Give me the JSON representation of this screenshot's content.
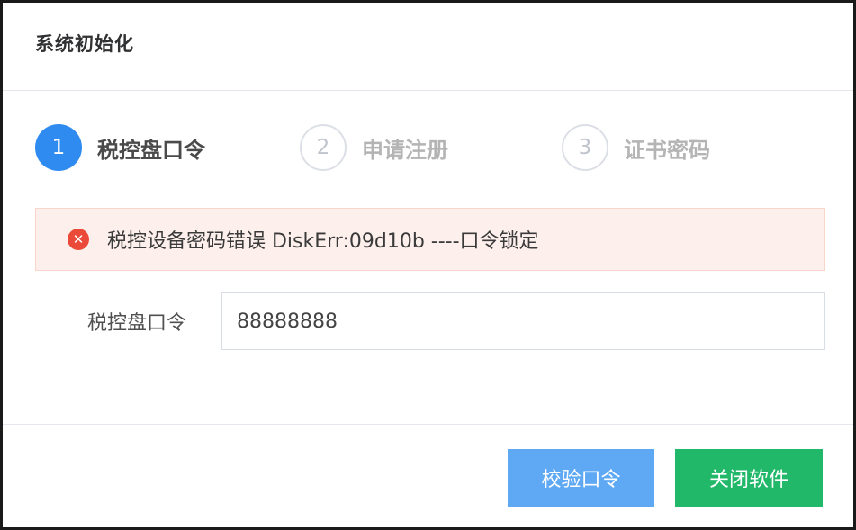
{
  "dialog": {
    "title": "系统初始化"
  },
  "steps": [
    {
      "number": "1",
      "label": "税控盘口令",
      "state": "active"
    },
    {
      "number": "2",
      "label": "申请注册",
      "state": "wait"
    },
    {
      "number": "3",
      "label": "证书密码",
      "state": "wait"
    }
  ],
  "alert": {
    "icon": "error-circle-icon",
    "message": "税控设备密码错误 DiskErr:09d10b ----口令锁定",
    "color": "#ea4a37"
  },
  "form": {
    "password_label": "税控盘口令",
    "password_value": "88888888"
  },
  "buttons": {
    "verify_label": "校验口令",
    "close_label": "关闭软件"
  },
  "colors": {
    "primary": "#2f8bf0",
    "success": "#21b86a",
    "danger": "#ea4a37"
  }
}
